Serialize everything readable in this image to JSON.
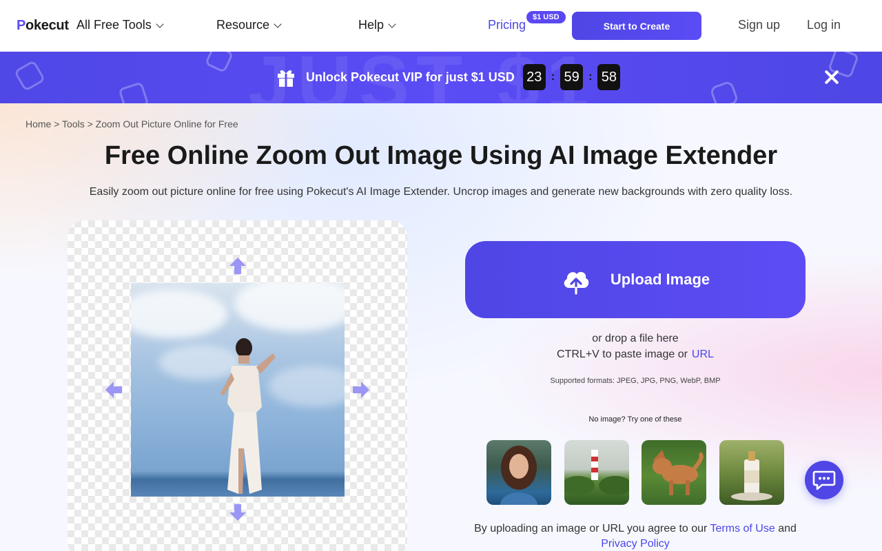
{
  "header": {
    "logo_p": "P",
    "logo_rest": "okecut",
    "nav": [
      "All Free Tools",
      "Resource",
      "Help"
    ],
    "pricing": "Pricing",
    "price_badge": "$1 USD",
    "start_button": "Start to Create",
    "signup": "Sign up",
    "login": "Log in"
  },
  "promo": {
    "text": "Unlock Pokecut VIP for just $1 USD",
    "timer": {
      "hours": "23",
      "minutes": "59",
      "seconds": "58"
    },
    "colon": ":"
  },
  "page": {
    "breadcrumb": "Home > Tools > Zoom Out Picture Online for Free",
    "title": "Free Online Zoom Out Image Using AI Image Extender",
    "subtitle": "Easily zoom out picture online for free using Pokecut's AI Image Extender. Uncrop images and generate new backgrounds with zero quality loss."
  },
  "upload": {
    "button": "Upload Image",
    "drop": "or drop a file here",
    "paste": "CTRL+V to paste image or",
    "url": "URL",
    "formats": "Supported formats: JPEG, JPG, PNG, WebP, BMP",
    "no_image": "No image? Try one of these",
    "terms_prefix": "By uploading an image or URL you agree to our",
    "terms_link": "Terms of Use",
    "and": "and",
    "privacy_link": "Privacy Policy"
  },
  "icons": {
    "chevron": "chevron-down-icon",
    "gift": "gift-icon",
    "close": "close-icon",
    "upload": "cloud-upload-icon",
    "chat": "chat-icon"
  },
  "colors": {
    "brand": "#4f46e5",
    "link": "#4b45e8",
    "timer_bg": "#111111"
  }
}
